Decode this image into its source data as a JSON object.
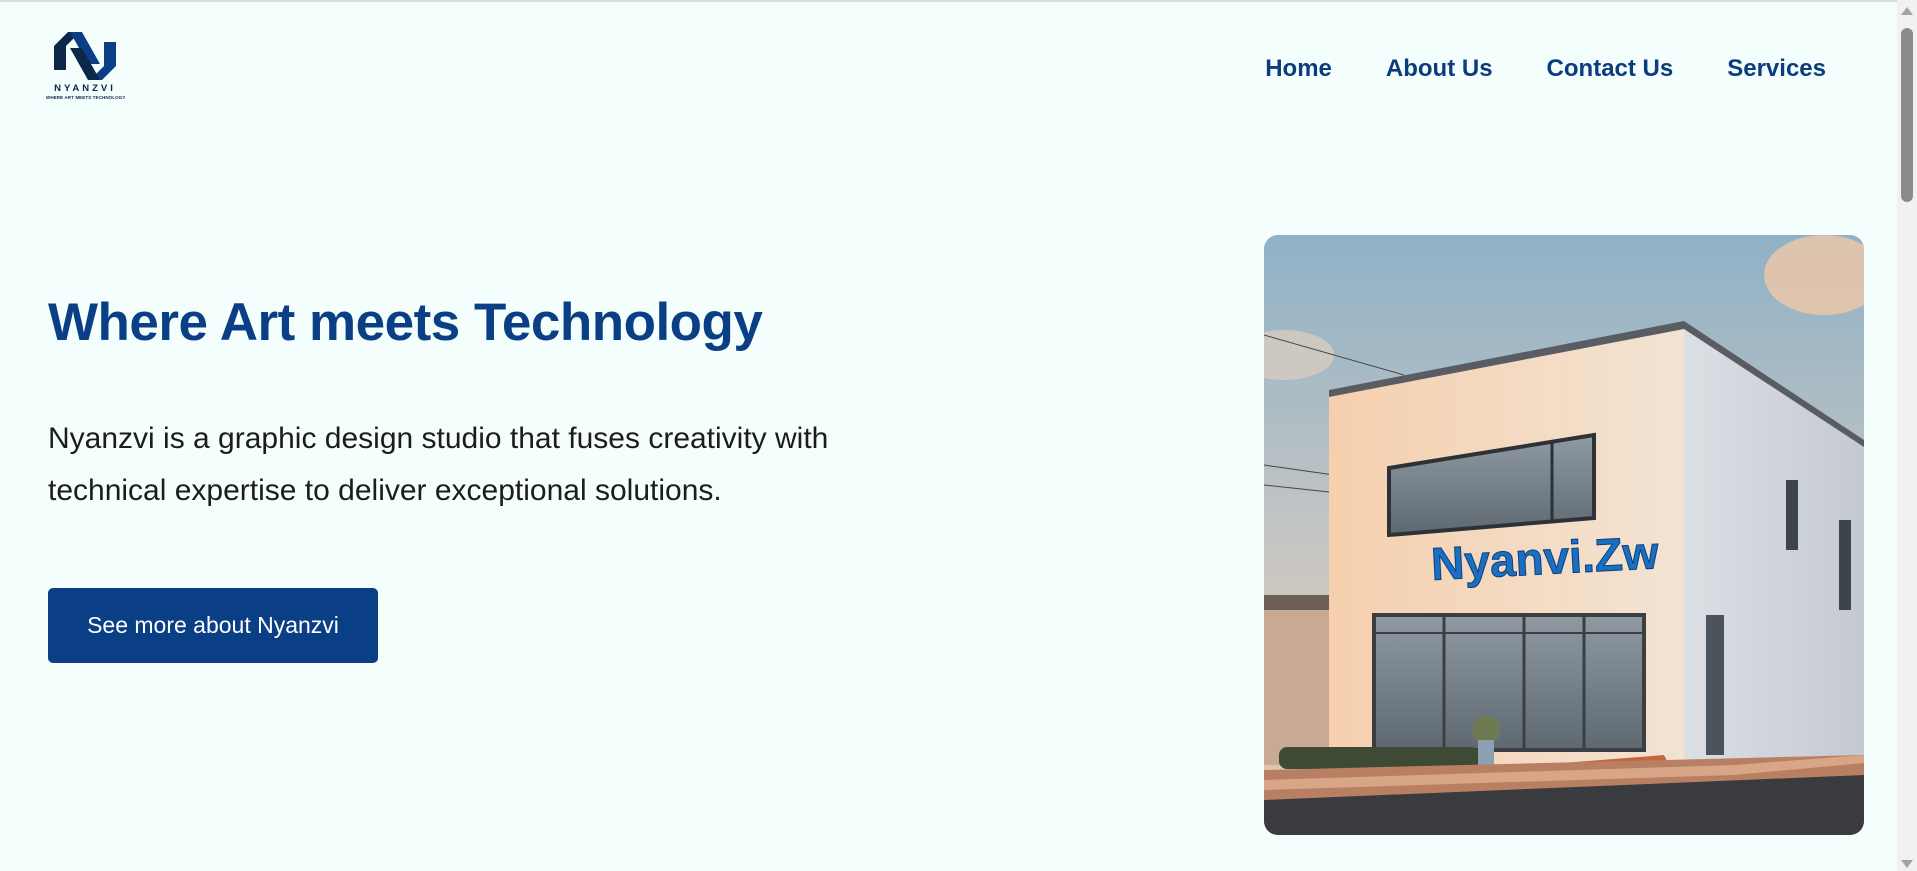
{
  "header": {
    "logo": {
      "name": "NYANZVI",
      "tagline": "WHERE ART MEETS TECHNOLOGY",
      "color": "#0d2748"
    },
    "nav": [
      "Home",
      "About Us",
      "Contact Us",
      "Services"
    ]
  },
  "hero": {
    "title": "Where Art meets Technology",
    "text": "Nyanzvi is a graphic design studio that fuses creativity with technical expertise to deliver exceptional solutions.",
    "cta_label": "See more about Nyanzvi",
    "image": {
      "sign_text": "Nyanvi.Zw"
    }
  },
  "colors": {
    "brand": "#0b3f85",
    "background": "#f4fefd",
    "button_text": "#ffffff"
  }
}
